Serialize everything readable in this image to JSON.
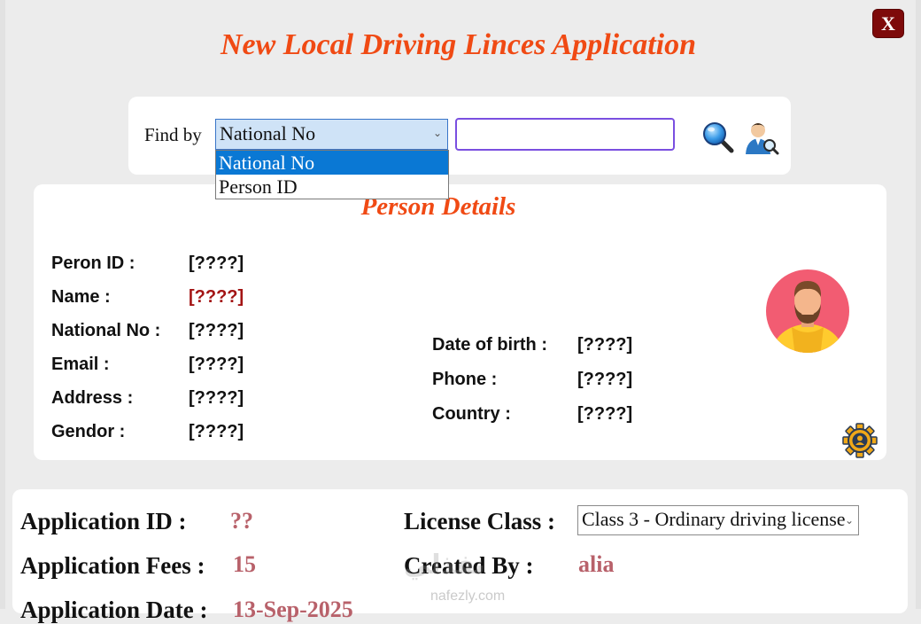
{
  "window": {
    "title": "New Local Driving Linces Application",
    "close_label": "X"
  },
  "find": {
    "label": "Find by",
    "selected": "National No",
    "options": [
      "National No",
      "Person ID"
    ],
    "search_value": ""
  },
  "person_details": {
    "title": "Person Details",
    "left_fields": [
      {
        "label": "Peron ID :",
        "value": "[????]"
      },
      {
        "label": "Name :",
        "value": "[????]"
      },
      {
        "label": "National No :",
        "value": "[????]"
      },
      {
        "label": "Email :",
        "value": "[????]"
      },
      {
        "label": "Address :",
        "value": "[????]"
      },
      {
        "label": "Gendor :",
        "value": "[????]"
      }
    ],
    "right_fields": [
      {
        "label": "Date of birth :",
        "value": "[????]"
      },
      {
        "label": "Phone :",
        "value": "[????]"
      },
      {
        "label": "Country :",
        "value": "[????]"
      }
    ]
  },
  "application": {
    "id_label": "Application ID :",
    "id_value": "??",
    "fees_label": "Application Fees :",
    "fees_value": "15",
    "date_label": "Application Date :",
    "date_value": "13-Sep-2025",
    "class_label": "License Class :",
    "class_value": "Class 3 - Ordinary driving license",
    "created_by_label": "Created By :",
    "created_by_value": "alia"
  },
  "watermark": {
    "arabic": "نفذلي",
    "site": "nafezly.com"
  },
  "colors": {
    "title_orange": "#f04a14",
    "close_red": "#7e0a0a",
    "value_red": "#a31414",
    "app_value": "#b8616a",
    "selection_blue": "#0a78d4"
  }
}
